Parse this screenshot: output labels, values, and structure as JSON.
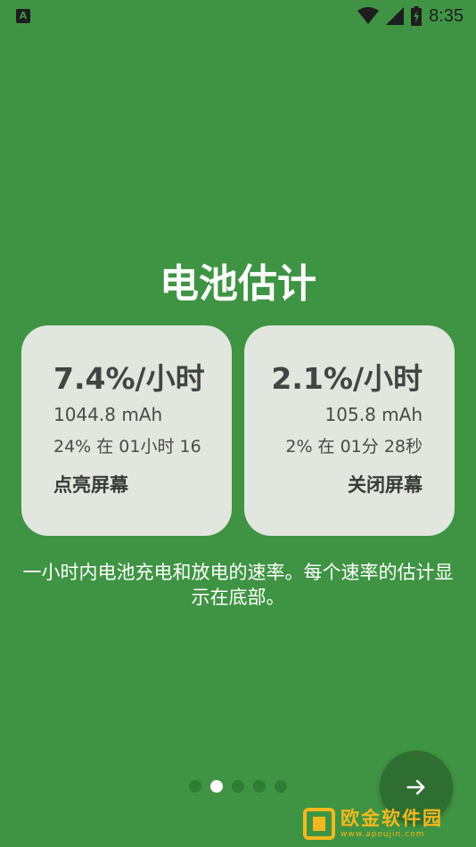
{
  "status_bar": {
    "time": "8:35",
    "app_icon_letter": "A",
    "icons": [
      "wifi-icon",
      "signal-icon",
      "battery-charging-icon"
    ]
  },
  "title": "电池估计",
  "cards": {
    "screen_on": {
      "rate": "7.4%/小时",
      "mah": "1044.8 mAh",
      "percent_time": "24% 在 01小时 16",
      "label": "点亮屏幕"
    },
    "screen_off": {
      "rate": "2.1%/小时",
      "mah": "105.8 mAh",
      "percent_time": "2% 在 01分 28秒",
      "label": "关闭屏幕"
    }
  },
  "description": "一小时内电池充电和放电的速率。每个速率的估计显示在底部。",
  "pager": {
    "count": 5,
    "active_index": 1
  },
  "next_button": {
    "icon": "arrow-right-icon"
  },
  "watermark": {
    "name": "欧金软件园",
    "url": "www.apoujin.com"
  },
  "colors": {
    "background": "#3f9443",
    "card": "#e1e6de",
    "fab": "#2e6e31",
    "watermark": "#f3b81f"
  }
}
